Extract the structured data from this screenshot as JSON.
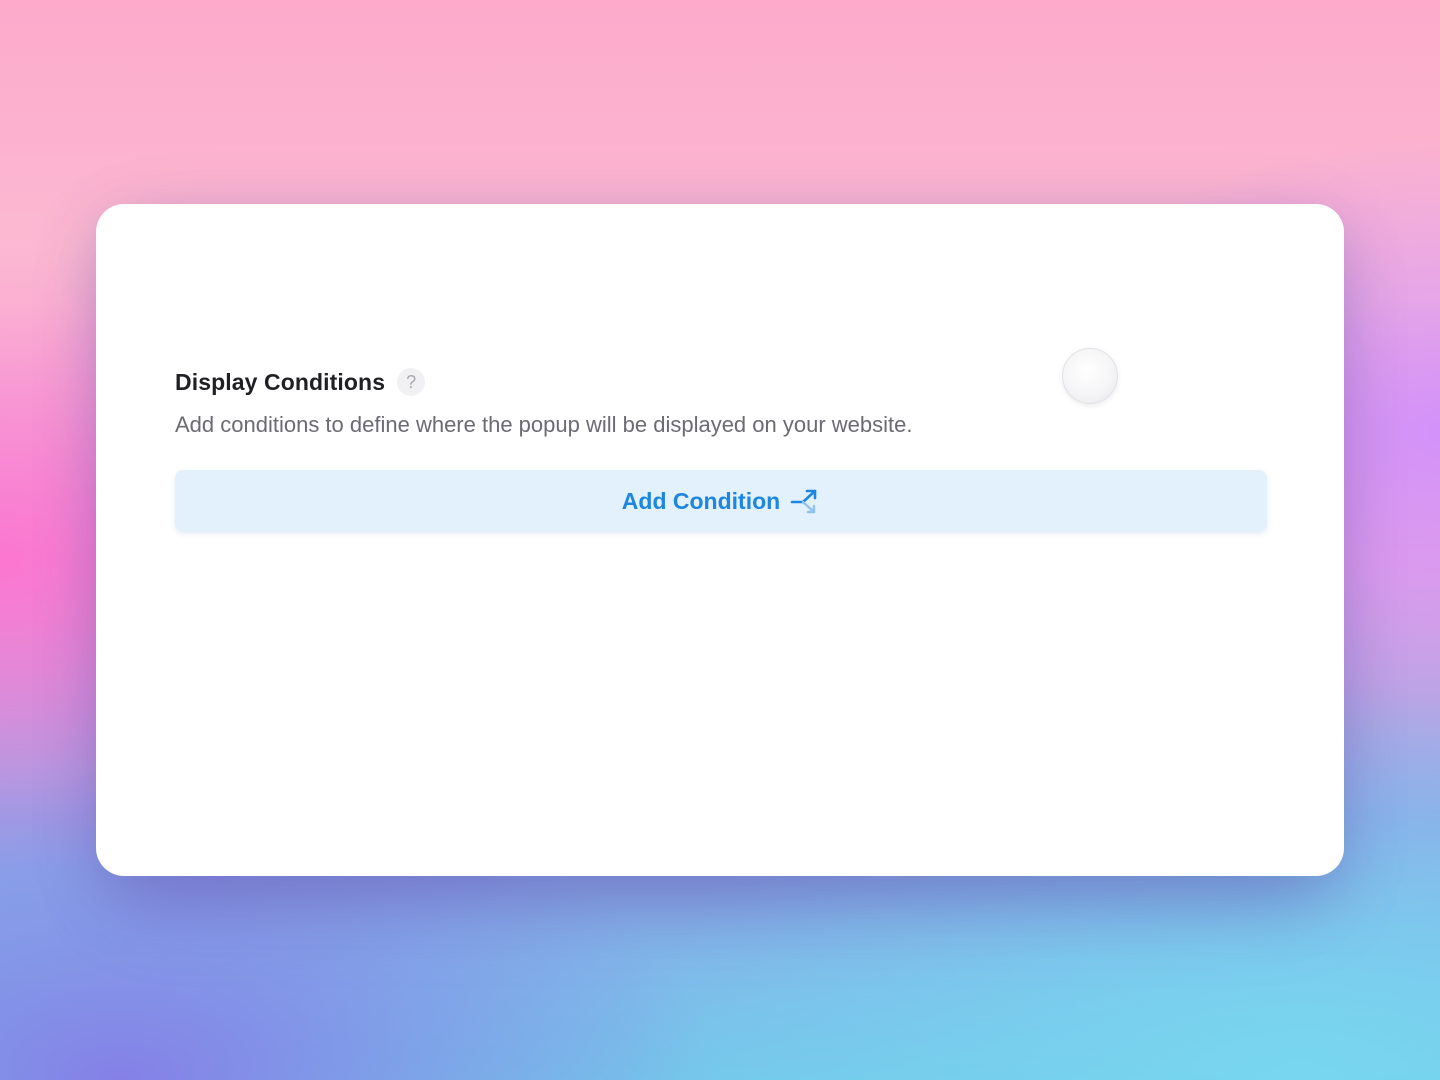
{
  "section": {
    "title": "Display Conditions",
    "help_glyph": "?",
    "description": "Add conditions to define where the popup will be displayed on your website."
  },
  "add_condition": {
    "label": "Add Condition",
    "icon": "branch-arrow-icon"
  },
  "colors": {
    "accent": "#1d86e0",
    "button_bg": "#e3f1fd",
    "title": "#1f1f24",
    "description": "#6b6b72"
  }
}
